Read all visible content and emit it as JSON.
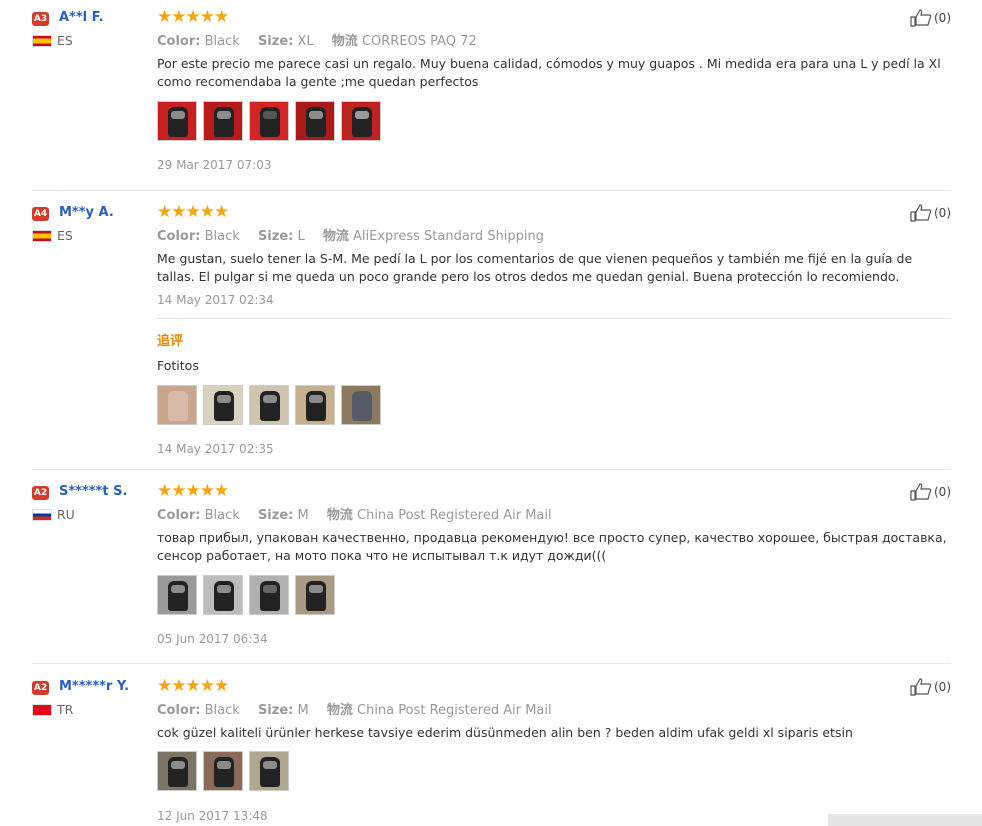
{
  "reviews": [
    {
      "badge": "A3",
      "name": "A**l F.",
      "country": "ES",
      "flag": "es",
      "stars": "★★★★★",
      "color_label": "Color:",
      "color_value": "Black",
      "size_label": "Size:",
      "size_value": "XL",
      "ship_label": "物流",
      "ship_value": "CORREOS PAQ 72",
      "text": "Por este precio me parece casi un regalo. Muy buena calidad, cómodos y muy guapos . Mi medida era para una L y pedí la Xl como recomendaba la gente ;me quedan perfectos",
      "date": "29 Mar 2017 07:03",
      "likes": "(0)"
    },
    {
      "badge": "A4",
      "name": "M**y A.",
      "country": "ES",
      "flag": "es",
      "stars": "★★★★★",
      "color_label": "Color:",
      "color_value": "Black",
      "size_label": "Size:",
      "size_value": "L",
      "ship_label": "物流",
      "ship_value": "AliExpress Standard Shipping",
      "text": "Me gustan, suelo tener la S-M. Me pedí la L por los comentarios de que vienen pequeños y también me fijé en la guía de tallas. El pulgar si me queda un poco grande pero los otros dedos me quedan genial. Buena protección lo recomiendo.",
      "date": "14 May 2017 02:34",
      "followup_label": "追评",
      "followup_text": "Fotitos",
      "followup_date": "14 May 2017 02:35",
      "likes": "(0)"
    },
    {
      "badge": "A2",
      "name": "S*****t S.",
      "country": "RU",
      "flag": "ru",
      "stars": "★★★★★",
      "color_label": "Color:",
      "color_value": "Black",
      "size_label": "Size:",
      "size_value": "M",
      "ship_label": "物流",
      "ship_value": "China Post Registered Air Mail",
      "text": "товар прибыл, упакован качественно, продавца рекомендую! все просто супер, качество хорошее, быстрая доставка, сенсор работает, на мото пока что не испытывал т.к идут дожди(((",
      "date": "05 Jun 2017 06:34",
      "likes": "(0)"
    },
    {
      "badge": "A2",
      "name": "M*****r Y.",
      "country": "TR",
      "flag": "tr",
      "stars": "★★★★★",
      "color_label": "Color:",
      "color_value": "Black",
      "size_label": "Size:",
      "size_value": "M",
      "ship_label": "物流",
      "ship_value": "China Post Registered Air Mail",
      "text": "cok güzel kaliteli ürünler herkese tavsiye ederim düsünmeden alin ben ? beden aldim ufak geldi xl siparis etsin",
      "date": "12 Jun 2017 13:48",
      "likes": "(0)"
    }
  ],
  "colors": {
    "badge": "#d33b2c",
    "name": "#2a5fbf",
    "stars": "#f5a413",
    "followup": "#e8860c"
  }
}
